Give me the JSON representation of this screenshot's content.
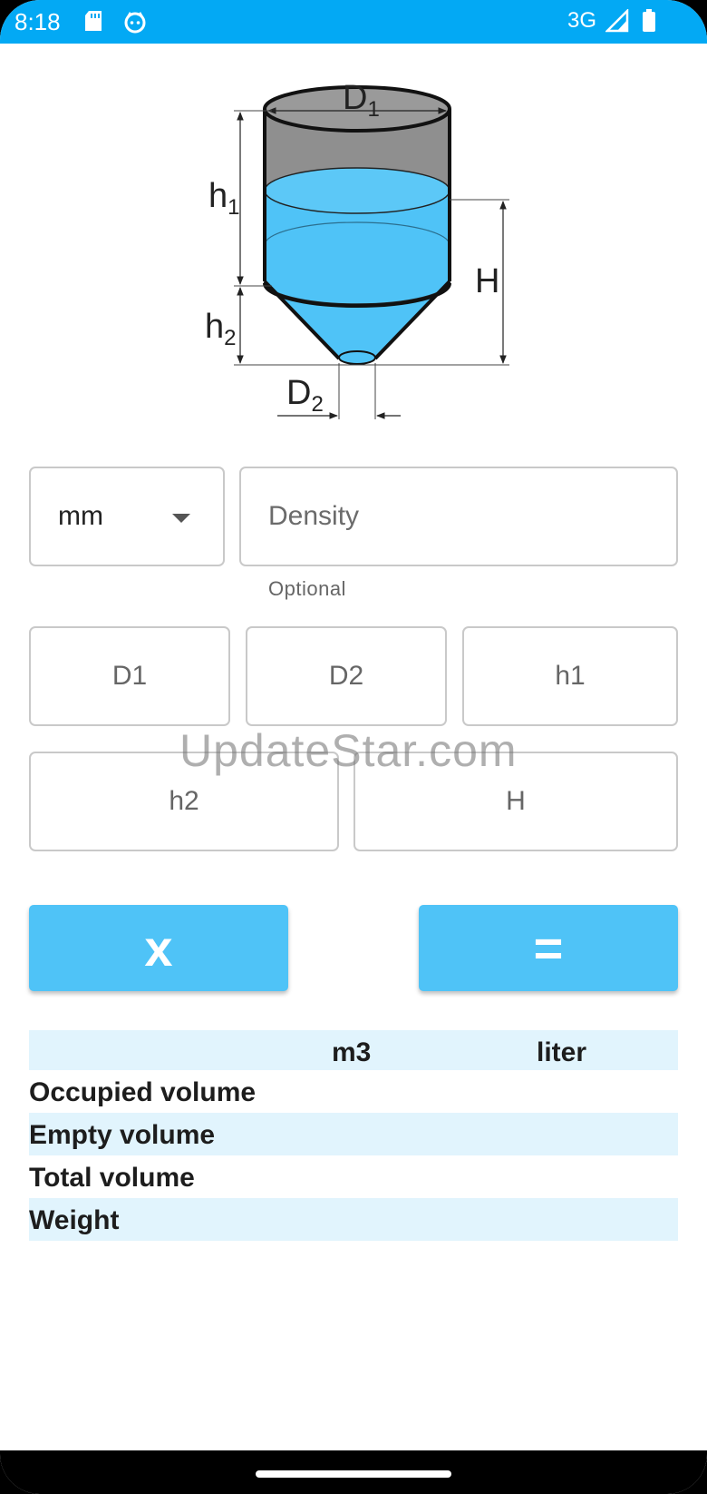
{
  "status_bar": {
    "time": "8:18",
    "network": "3G"
  },
  "diagram": {
    "labels": {
      "d1": "D",
      "d1_sub": "1",
      "d2": "D",
      "d2_sub": "2",
      "h1": "h",
      "h1_sub": "1",
      "h2": "h",
      "h2_sub": "2",
      "h": "H"
    },
    "colors": {
      "liquid": "#4fc3f7",
      "empty": "#8f8f8f"
    }
  },
  "form": {
    "unit": "mm",
    "density_placeholder": "Density",
    "density_helper": "Optional",
    "inputs": {
      "d1": "D1",
      "d2": "D2",
      "h1": "h1",
      "h2": "h2",
      "h": "H"
    }
  },
  "watermark": "UpdateStar.com",
  "buttons": {
    "clear": "x",
    "calculate": "="
  },
  "results": {
    "headers": [
      "",
      "m3",
      "liter"
    ],
    "rows": [
      {
        "label": "Occupied volume",
        "m3": "",
        "liter": ""
      },
      {
        "label": "Empty volume",
        "m3": "",
        "liter": ""
      },
      {
        "label": "Total volume",
        "m3": "",
        "liter": ""
      },
      {
        "label": "Weight",
        "m3": "",
        "liter": ""
      }
    ]
  },
  "colors": {
    "accent": "#03a9f4",
    "button": "#4fc3f7",
    "row_shade": "#e1f4fd"
  }
}
